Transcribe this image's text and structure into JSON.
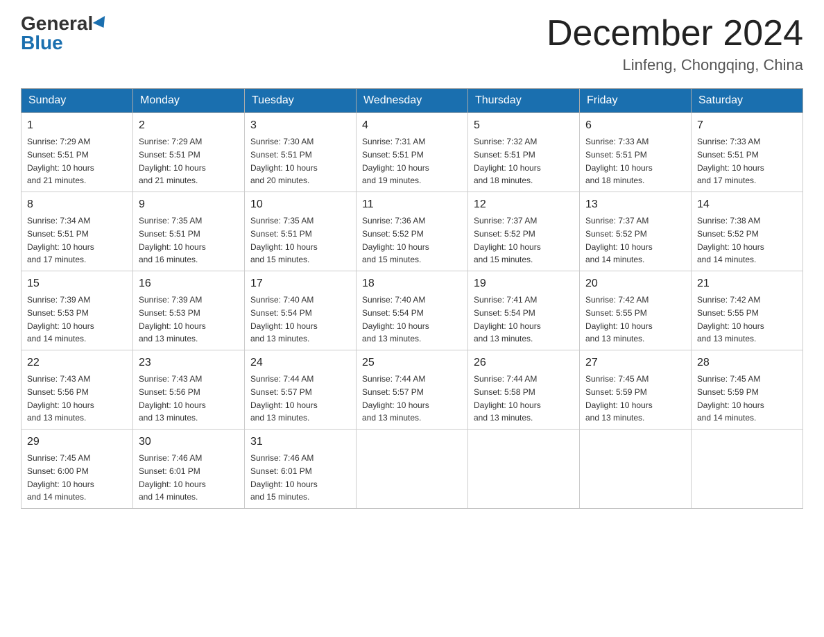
{
  "header": {
    "logo_general": "General",
    "logo_blue": "Blue",
    "month_title": "December 2024",
    "location": "Linfeng, Chongqing, China"
  },
  "days_of_week": [
    "Sunday",
    "Monday",
    "Tuesday",
    "Wednesday",
    "Thursday",
    "Friday",
    "Saturday"
  ],
  "weeks": [
    [
      {
        "day": "1",
        "sunrise": "7:29 AM",
        "sunset": "5:51 PM",
        "daylight": "10 hours and 21 minutes."
      },
      {
        "day": "2",
        "sunrise": "7:29 AM",
        "sunset": "5:51 PM",
        "daylight": "10 hours and 21 minutes."
      },
      {
        "day": "3",
        "sunrise": "7:30 AM",
        "sunset": "5:51 PM",
        "daylight": "10 hours and 20 minutes."
      },
      {
        "day": "4",
        "sunrise": "7:31 AM",
        "sunset": "5:51 PM",
        "daylight": "10 hours and 19 minutes."
      },
      {
        "day": "5",
        "sunrise": "7:32 AM",
        "sunset": "5:51 PM",
        "daylight": "10 hours and 18 minutes."
      },
      {
        "day": "6",
        "sunrise": "7:33 AM",
        "sunset": "5:51 PM",
        "daylight": "10 hours and 18 minutes."
      },
      {
        "day": "7",
        "sunrise": "7:33 AM",
        "sunset": "5:51 PM",
        "daylight": "10 hours and 17 minutes."
      }
    ],
    [
      {
        "day": "8",
        "sunrise": "7:34 AM",
        "sunset": "5:51 PM",
        "daylight": "10 hours and 17 minutes."
      },
      {
        "day": "9",
        "sunrise": "7:35 AM",
        "sunset": "5:51 PM",
        "daylight": "10 hours and 16 minutes."
      },
      {
        "day": "10",
        "sunrise": "7:35 AM",
        "sunset": "5:51 PM",
        "daylight": "10 hours and 15 minutes."
      },
      {
        "day": "11",
        "sunrise": "7:36 AM",
        "sunset": "5:52 PM",
        "daylight": "10 hours and 15 minutes."
      },
      {
        "day": "12",
        "sunrise": "7:37 AM",
        "sunset": "5:52 PM",
        "daylight": "10 hours and 15 minutes."
      },
      {
        "day": "13",
        "sunrise": "7:37 AM",
        "sunset": "5:52 PM",
        "daylight": "10 hours and 14 minutes."
      },
      {
        "day": "14",
        "sunrise": "7:38 AM",
        "sunset": "5:52 PM",
        "daylight": "10 hours and 14 minutes."
      }
    ],
    [
      {
        "day": "15",
        "sunrise": "7:39 AM",
        "sunset": "5:53 PM",
        "daylight": "10 hours and 14 minutes."
      },
      {
        "day": "16",
        "sunrise": "7:39 AM",
        "sunset": "5:53 PM",
        "daylight": "10 hours and 13 minutes."
      },
      {
        "day": "17",
        "sunrise": "7:40 AM",
        "sunset": "5:54 PM",
        "daylight": "10 hours and 13 minutes."
      },
      {
        "day": "18",
        "sunrise": "7:40 AM",
        "sunset": "5:54 PM",
        "daylight": "10 hours and 13 minutes."
      },
      {
        "day": "19",
        "sunrise": "7:41 AM",
        "sunset": "5:54 PM",
        "daylight": "10 hours and 13 minutes."
      },
      {
        "day": "20",
        "sunrise": "7:42 AM",
        "sunset": "5:55 PM",
        "daylight": "10 hours and 13 minutes."
      },
      {
        "day": "21",
        "sunrise": "7:42 AM",
        "sunset": "5:55 PM",
        "daylight": "10 hours and 13 minutes."
      }
    ],
    [
      {
        "day": "22",
        "sunrise": "7:43 AM",
        "sunset": "5:56 PM",
        "daylight": "10 hours and 13 minutes."
      },
      {
        "day": "23",
        "sunrise": "7:43 AM",
        "sunset": "5:56 PM",
        "daylight": "10 hours and 13 minutes."
      },
      {
        "day": "24",
        "sunrise": "7:44 AM",
        "sunset": "5:57 PM",
        "daylight": "10 hours and 13 minutes."
      },
      {
        "day": "25",
        "sunrise": "7:44 AM",
        "sunset": "5:57 PM",
        "daylight": "10 hours and 13 minutes."
      },
      {
        "day": "26",
        "sunrise": "7:44 AM",
        "sunset": "5:58 PM",
        "daylight": "10 hours and 13 minutes."
      },
      {
        "day": "27",
        "sunrise": "7:45 AM",
        "sunset": "5:59 PM",
        "daylight": "10 hours and 13 minutes."
      },
      {
        "day": "28",
        "sunrise": "7:45 AM",
        "sunset": "5:59 PM",
        "daylight": "10 hours and 14 minutes."
      }
    ],
    [
      {
        "day": "29",
        "sunrise": "7:45 AM",
        "sunset": "6:00 PM",
        "daylight": "10 hours and 14 minutes."
      },
      {
        "day": "30",
        "sunrise": "7:46 AM",
        "sunset": "6:01 PM",
        "daylight": "10 hours and 14 minutes."
      },
      {
        "day": "31",
        "sunrise": "7:46 AM",
        "sunset": "6:01 PM",
        "daylight": "10 hours and 15 minutes."
      },
      null,
      null,
      null,
      null
    ]
  ],
  "labels": {
    "sunrise": "Sunrise:",
    "sunset": "Sunset:",
    "daylight": "Daylight:"
  }
}
